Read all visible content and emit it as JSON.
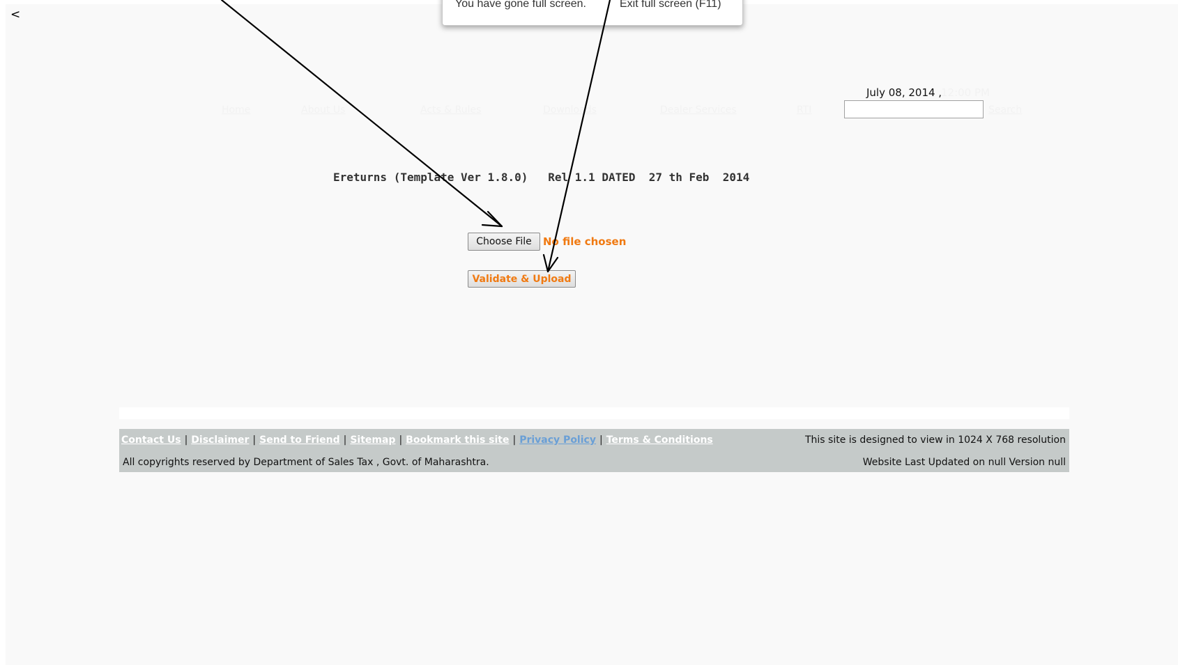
{
  "browser": {
    "back_glyph": "<",
    "fullscreen_message": "You have gone full screen.",
    "exit_fullscreen": "Exit full screen (F11)"
  },
  "header": {
    "date": "July 08, 2014 ,",
    "time": "12:00 PM",
    "nav": [
      {
        "label": "Home"
      },
      {
        "label": "About Us"
      },
      {
        "label": "Acts & Rules"
      },
      {
        "label": "Downloads"
      },
      {
        "label": "Dealer Services"
      },
      {
        "label": "RTI"
      }
    ],
    "search": {
      "value": "",
      "link_label": "Search"
    }
  },
  "main": {
    "version_title": "Ereturns (Template Ver 1.8.0)   Rel 1.1 DATED  27 th Feb  2014",
    "choose_file_label": "Choose File",
    "no_file_text": "No file chosen",
    "upload_label": "Validate & Upload"
  },
  "footer": {
    "links": [
      {
        "label": "Contact Us"
      },
      {
        "label": "Disclaimer"
      },
      {
        "label": "Send to Friend"
      },
      {
        "label": "Sitemap"
      },
      {
        "label": "Bookmark this site"
      },
      {
        "label": "Privacy Policy"
      },
      {
        "label": "Terms & Conditions"
      }
    ],
    "resolution_note": "This site is designed to view in 1024 X 768 resolution",
    "copyright": "All copyrights reserved by Department of Sales Tax , Govt. of Maharashtra.",
    "last_updated": "Website Last Updated on null Version null"
  },
  "colors": {
    "page_bg": "#f9f9f9",
    "accent_orange": "#f07a12",
    "footer_bg": "#c5cac9",
    "privacy_link": "#6a9fd6"
  }
}
